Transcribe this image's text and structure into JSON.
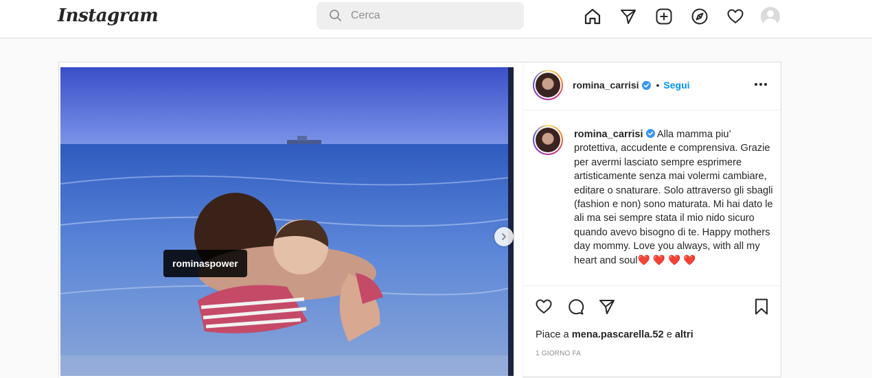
{
  "brand": {
    "logo_text": "Instagram"
  },
  "search": {
    "placeholder": "Cerca"
  },
  "nav": {
    "icons": [
      "home-icon",
      "direct-message-icon",
      "new-post-icon",
      "explore-icon",
      "activity-heart-icon",
      "profile-avatar"
    ]
  },
  "post": {
    "author": "romina_carrisi",
    "verified": true,
    "dot": "•",
    "follow_label": "Segui",
    "more_icon": "more-options-icon",
    "photo_tag": "rominaspower",
    "caption": {
      "author": "romina_carrisi",
      "text": "Alla mamma piu’ protettiva, accudente e comprensiva. Grazie per avermi lasciato sempre esprimere artisticamente senza mai volermi cambiare, editare o snaturare. Solo attraverso gli sbagli (fashion e non) sono maturata. Mi hai dato le ali ma sei sempre stata il mio nido sicuro quando avevo bisogno di te. Happy mothers day mommy. Love you always, with all my heart and soul",
      "hearts": "❤️ ❤️ ❤️ ❤️"
    },
    "likes": {
      "prefix": "Piace a",
      "user": "mena.pascarella.52",
      "middle": "e",
      "suffix": "altri"
    },
    "time": "1 GIORNO FA"
  },
  "colors": {
    "accent": "#0095f6",
    "border": "#dbdbdb",
    "text": "#262626",
    "muted": "#8e8e8e",
    "heart": "#ed4956"
  }
}
